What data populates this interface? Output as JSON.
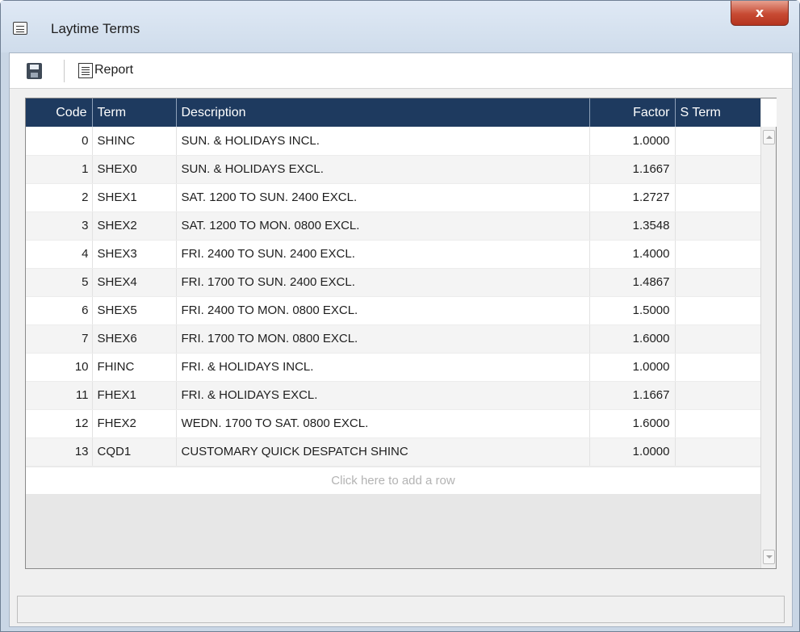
{
  "window": {
    "title": "Laytime Terms",
    "close_label": "x"
  },
  "toolbar": {
    "report_label": "Report"
  },
  "grid": {
    "columns": {
      "code": "Code",
      "term": "Term",
      "description": "Description",
      "factor": "Factor",
      "sterm": "S Term"
    },
    "rows": [
      {
        "code": "0",
        "term": "SHINC",
        "description": "SUN. & HOLIDAYS INCL.",
        "factor": "1.0000",
        "sterm": ""
      },
      {
        "code": "1",
        "term": "SHEX0",
        "description": "SUN. & HOLIDAYS EXCL.",
        "factor": "1.1667",
        "sterm": ""
      },
      {
        "code": "2",
        "term": "SHEX1",
        "description": "SAT. 1200 TO SUN. 2400 EXCL.",
        "factor": "1.2727",
        "sterm": ""
      },
      {
        "code": "3",
        "term": "SHEX2",
        "description": "SAT. 1200 TO MON. 0800 EXCL.",
        "factor": "1.3548",
        "sterm": ""
      },
      {
        "code": "4",
        "term": "SHEX3",
        "description": "FRI. 2400 TO SUN. 2400 EXCL.",
        "factor": "1.4000",
        "sterm": ""
      },
      {
        "code": "5",
        "term": "SHEX4",
        "description": "FRI. 1700 TO SUN. 2400 EXCL.",
        "factor": "1.4867",
        "sterm": ""
      },
      {
        "code": "6",
        "term": "SHEX5",
        "description": "FRI. 2400 TO MON. 0800 EXCL.",
        "factor": "1.5000",
        "sterm": ""
      },
      {
        "code": "7",
        "term": "SHEX6",
        "description": "FRI. 1700 TO MON. 0800 EXCL.",
        "factor": "1.6000",
        "sterm": ""
      },
      {
        "code": "10",
        "term": "FHINC",
        "description": "FRI. & HOLIDAYS INCL.",
        "factor": "1.0000",
        "sterm": ""
      },
      {
        "code": "11",
        "term": "FHEX1",
        "description": "FRI. & HOLIDAYS EXCL.",
        "factor": "1.1667",
        "sterm": ""
      },
      {
        "code": "12",
        "term": "FHEX2",
        "description": "WEDN. 1700 TO SAT. 0800 EXCL.",
        "factor": "1.6000",
        "sterm": ""
      },
      {
        "code": "13",
        "term": "CQD1",
        "description": "CUSTOMARY QUICK DESPATCH SHINC",
        "factor": "1.0000",
        "sterm": ""
      }
    ],
    "add_row_label": "Click here to add a row"
  },
  "icons": {
    "window_icon": "list-icon",
    "save": "save-icon",
    "report": "report-icon"
  },
  "colors": {
    "header_bg": "#1e3a5f",
    "close_button": "#c74a33"
  }
}
